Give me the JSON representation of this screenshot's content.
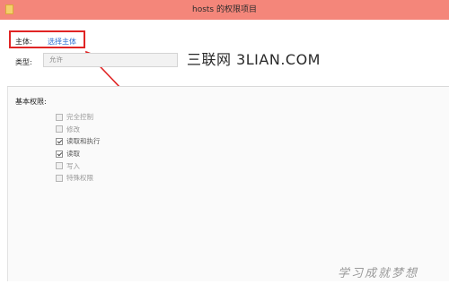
{
  "window": {
    "title": "hosts 的权限项目",
    "titlebar_color": "#f4867a"
  },
  "principal": {
    "label": "主体:",
    "link": "选择主体",
    "link_color": "#2f6fd0"
  },
  "annotation": {
    "color": "#e02424"
  },
  "type": {
    "label": "类型:",
    "value": "允许"
  },
  "watermarks": {
    "top": "三联网 3LIAN.COM",
    "bottom": "学习成就梦想"
  },
  "permissions": {
    "title": "基本权限:",
    "items": [
      {
        "label": "完全控制",
        "checked": false
      },
      {
        "label": "修改",
        "checked": false
      },
      {
        "label": "读取和执行",
        "checked": true
      },
      {
        "label": "读取",
        "checked": true
      },
      {
        "label": "写入",
        "checked": false
      },
      {
        "label": "特殊权限",
        "checked": false
      }
    ]
  }
}
